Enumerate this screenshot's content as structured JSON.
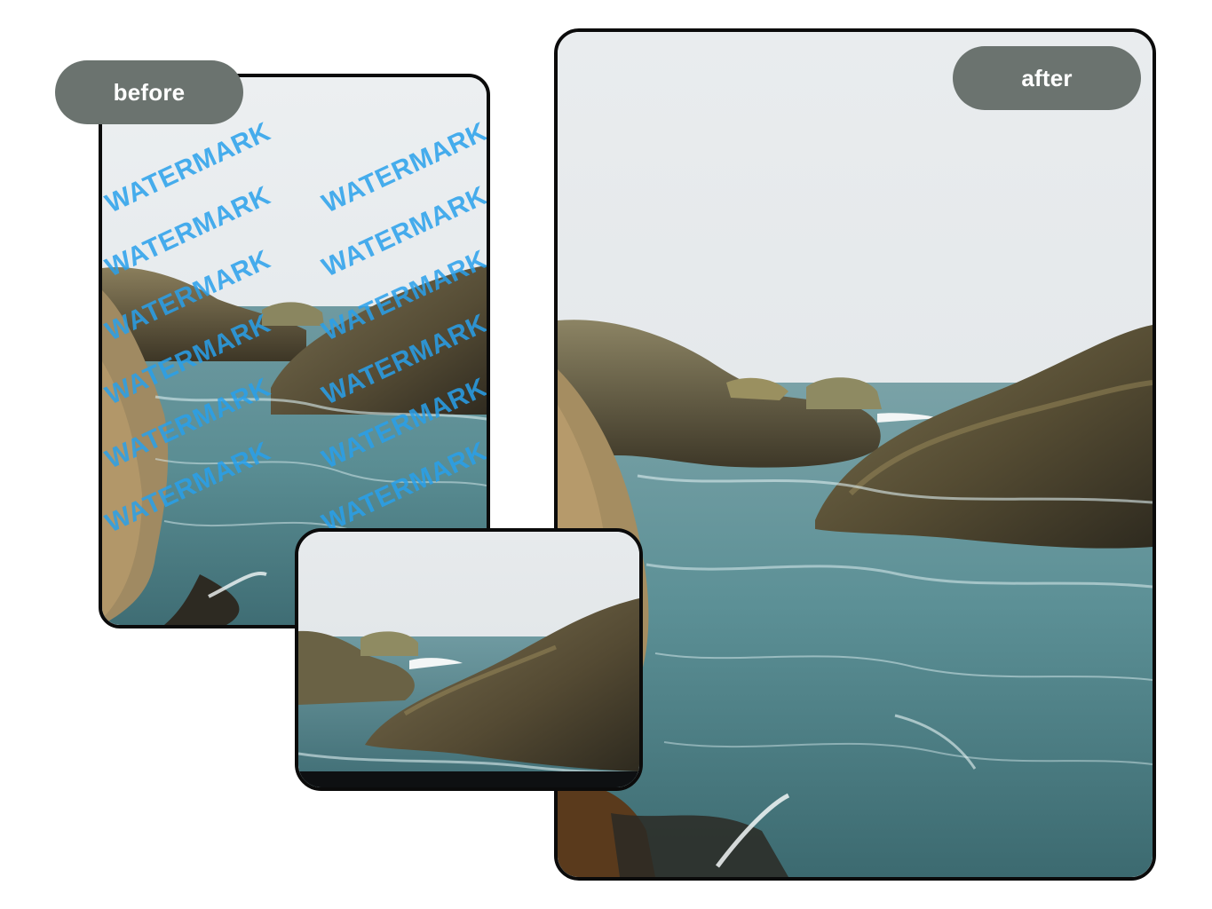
{
  "labels": {
    "before": "before",
    "after": "after"
  },
  "watermark": {
    "text": "WATERMARK",
    "color": "#28a0eb"
  },
  "colors": {
    "label_background": "#6b736f",
    "frame_border": "#0b0b0b",
    "sky": "#e6eaec",
    "sea": "#5f8f96",
    "rock": "#5d5a44"
  }
}
